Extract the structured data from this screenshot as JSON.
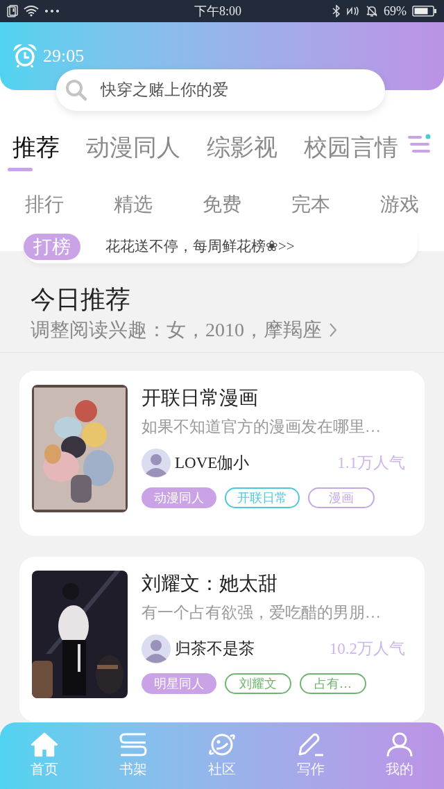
{
  "status_bar": {
    "time": "下午8:00",
    "battery": "69%"
  },
  "timer": {
    "value": "29:05"
  },
  "search": {
    "placeholder": "快穿之赌上你的爱"
  },
  "tabs": [
    {
      "label": "推荐",
      "selected": true
    },
    {
      "label": "动漫同人",
      "selected": false
    },
    {
      "label": "综影视",
      "selected": false
    },
    {
      "label": "校园言情",
      "selected": false
    }
  ],
  "shortcuts": [
    "排行",
    "精选",
    "免费",
    "完本",
    "游戏"
  ],
  "banner": {
    "badge": "打榜",
    "text": "花花送不停，每周鲜花榜❀>>"
  },
  "section": {
    "title": "今日推荐",
    "subtitle": "调整阅读兴趣：女，2010，摩羯座"
  },
  "books": [
    {
      "title": "开联日常漫画",
      "description": "如果不知道官方的漫画发在哪里…",
      "author": "LOVE伽小",
      "popularity": "1.1万人气",
      "cover": {
        "kind": "picture"
      },
      "tags": [
        {
          "label": "动漫同人",
          "kind": "filled",
          "color": "#c9a3e6"
        },
        {
          "label": "开联日常",
          "kind": "outline",
          "color": "#4cc9d9"
        },
        {
          "label": "漫画",
          "kind": "outline",
          "color": "#c4a8e2"
        }
      ]
    },
    {
      "title": "刘耀文：她太甜",
      "description": "有一个占有欲强，爱吃醋的男朋…",
      "author": "归茶不是茶",
      "popularity": "10.2万人气",
      "cover": {
        "kind": "picture"
      },
      "tags": [
        {
          "label": "明星同人",
          "kind": "filled",
          "color": "#c9a3e6"
        },
        {
          "label": "刘耀文",
          "kind": "outline",
          "color": "#6fb46f"
        },
        {
          "label": "占有…",
          "kind": "outline",
          "color": "#6fb46f"
        }
      ]
    }
  ],
  "nav": [
    {
      "label": "首页",
      "selected": true
    },
    {
      "label": "书架",
      "selected": false
    },
    {
      "label": "社区",
      "selected": false
    },
    {
      "label": "写作",
      "selected": false
    },
    {
      "label": "我的",
      "selected": false
    }
  ]
}
